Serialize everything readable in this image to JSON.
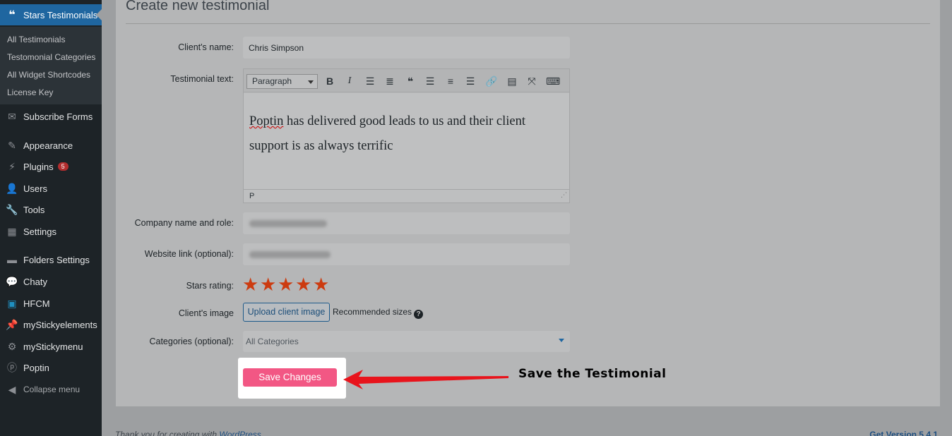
{
  "sidebar": {
    "current": {
      "label": "Stars Testimonials",
      "icon": "quote-icon"
    },
    "submenu": [
      "All Testimonials",
      "Testomonial Categories",
      "All Widget Shortcodes",
      "License Key"
    ],
    "items": [
      {
        "label": "Subscribe Forms",
        "icon": "envelope-icon"
      },
      {
        "label": "Appearance",
        "icon": "paintbrush-icon"
      },
      {
        "label": "Plugins",
        "icon": "plug-icon",
        "badge": "5"
      },
      {
        "label": "Users",
        "icon": "user-icon"
      },
      {
        "label": "Tools",
        "icon": "wrench-icon"
      },
      {
        "label": "Settings",
        "icon": "sliders-icon"
      },
      {
        "label": "Folders Settings",
        "icon": "folder-icon"
      },
      {
        "label": "Chaty",
        "icon": "chat-icon"
      },
      {
        "label": "HFCM",
        "icon": "robot-icon"
      },
      {
        "label": "myStickyelements",
        "icon": "pin-icon"
      },
      {
        "label": "myStickymenu",
        "icon": "gear-icon"
      },
      {
        "label": "Poptin",
        "icon": "poptin-logo-icon"
      }
    ],
    "collapse": "Collapse menu"
  },
  "form": {
    "title": "Create new testimonial",
    "client_name_label": "Client's name:",
    "client_name_value": "Chris Simpson",
    "testimonial_label": "Testimonial text:",
    "format_select": "Paragraph",
    "content_word1": "Poptin",
    "content_rest": " has delivered good leads to us and their client support is as always terrific",
    "status_path": "P",
    "company_label": "Company name and role:",
    "website_label": "Website link (optional):",
    "stars_label": "Stars rating:",
    "stars_value": 5,
    "stars_max": 5,
    "image_label": "Client's image",
    "upload_button": "Upload client image",
    "recommended": "Recommended sizes",
    "help_glyph": "?",
    "categories_label": "Categories (optional):",
    "categories_value": "All Categories",
    "save_button": "Save Changes"
  },
  "annotation": "Save the Testimonial",
  "footer": {
    "thanks": "Thank you for creating with ",
    "wp_link": "WordPress",
    "version": "Get Version 5.4.1"
  },
  "colors": {
    "accent": "#1f66a0",
    "save": "#f25784",
    "stars": "#cc3b10",
    "arrow": "#e8141c"
  }
}
